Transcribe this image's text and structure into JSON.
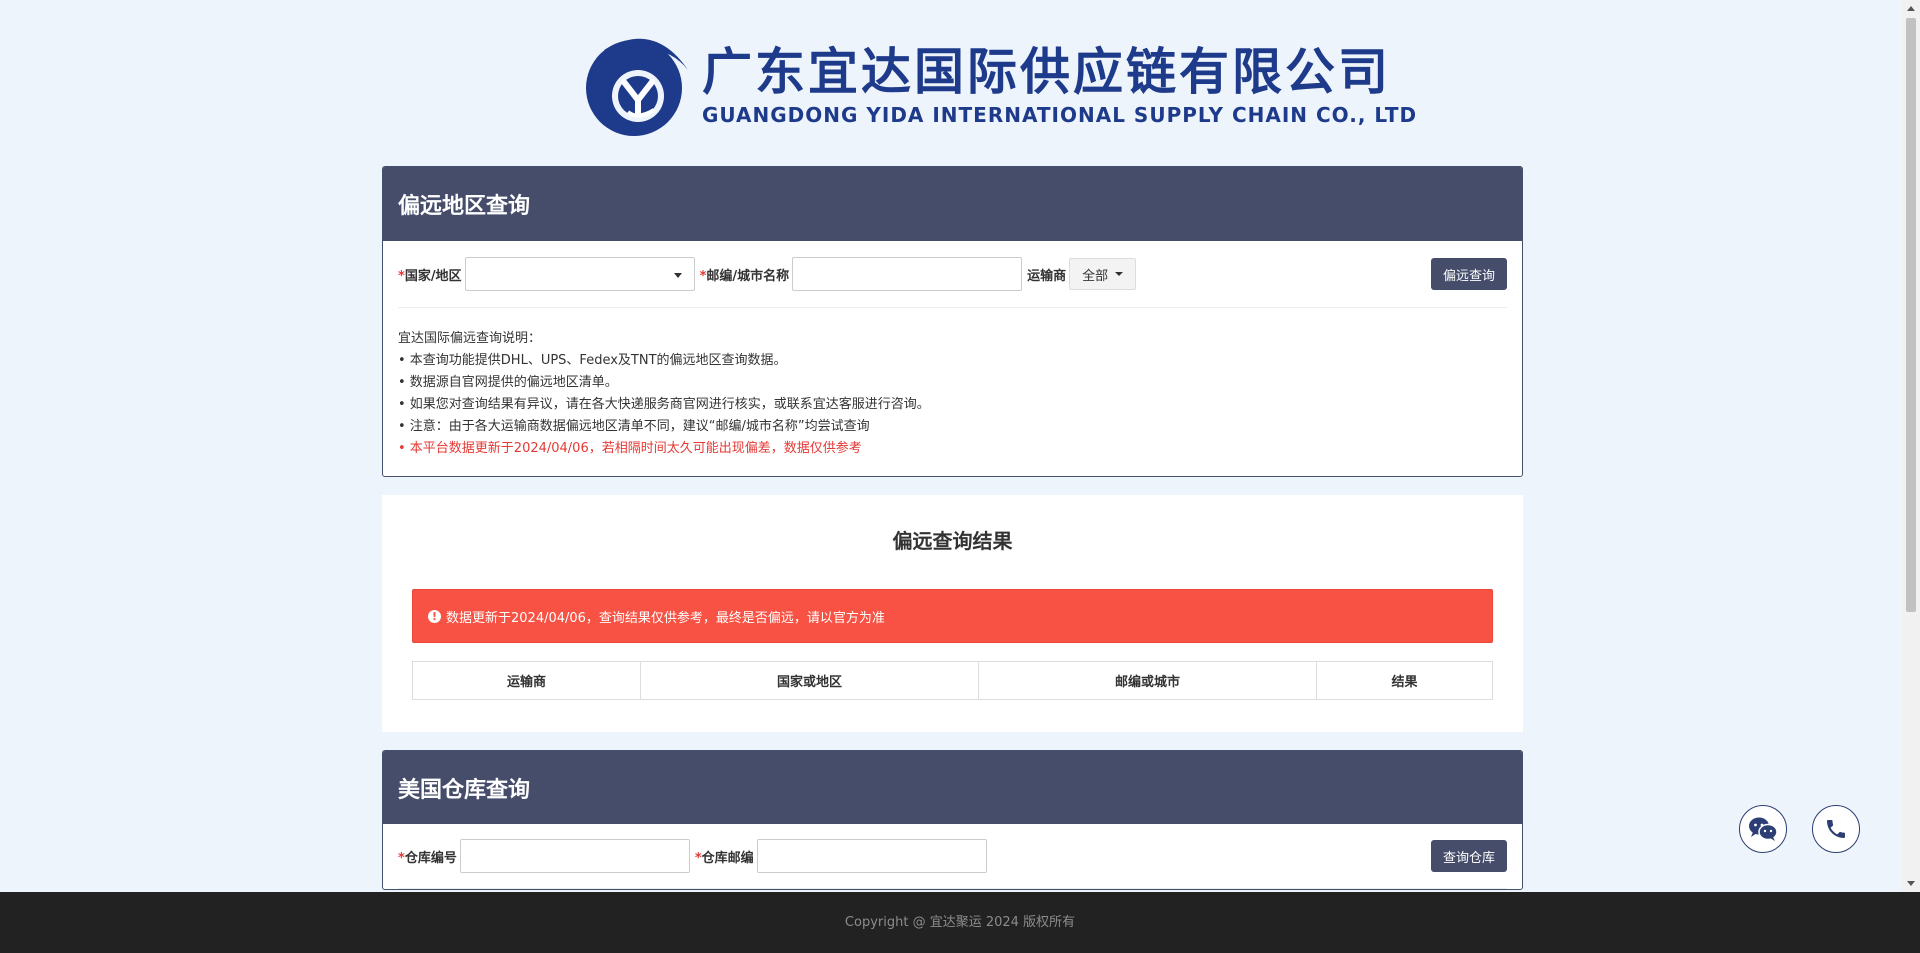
{
  "header": {
    "company_cn": "广东宜达国际供应链有限公司",
    "company_en": "GUANGDONG YIDA INTERNATIONAL  SUPPLY CHAIN CO., LTD",
    "logo_icon": "yida-logo-icon",
    "brand_color": "#1e3a8a"
  },
  "remote_query": {
    "title": "偏远地区查询",
    "country_label": "国家/地区",
    "postal_label": "邮编/城市名称",
    "carrier_label": "运输商",
    "carrier_value": "全部",
    "submit_label": "偏远查询",
    "required_mark": "*",
    "notes": {
      "heading": "宜达国际偏远查询说明：",
      "items": [
        "• 本查询功能提供DHL、UPS、Fedex及TNT的偏远地区查询数据。",
        "• 数据源自官网提供的偏远地区清单。",
        "• 如果您对查询结果有异议，请在各大快递服务商官网进行核实，或联系宜达客服进行咨询。",
        "• 注意：由于各大运输商数据偏远地区清单不同，建议“邮编/城市名称”均尝试查询"
      ],
      "warning": "• 本平台数据更新于2024/04/06，若相隔时间太久可能出现偏差，数据仅供参考"
    }
  },
  "results": {
    "title": "偏远查询结果",
    "alert_icon": "exclamation-circle-icon",
    "alert_text": "数据更新于2024/04/06，查询结果仅供参考，最终是否偏远，请以官方为准",
    "columns": [
      "运输商",
      "国家或地区",
      "邮编或城市",
      "结果"
    ]
  },
  "warehouse_query": {
    "title": "美国仓库查询",
    "code_label": "仓库编号",
    "postal_label": "仓库邮编",
    "submit_label": "查询仓库"
  },
  "floating": {
    "wechat_icon": "wechat-icon",
    "phone_icon": "phone-icon"
  },
  "footer": {
    "copyright": "Copyright @ 宜达聚运 2024 版权所有"
  },
  "colors": {
    "panel_header": "#454d6a",
    "alert": "#f75243",
    "page_bg": "#eef4fb",
    "footer_bg": "#222222"
  }
}
